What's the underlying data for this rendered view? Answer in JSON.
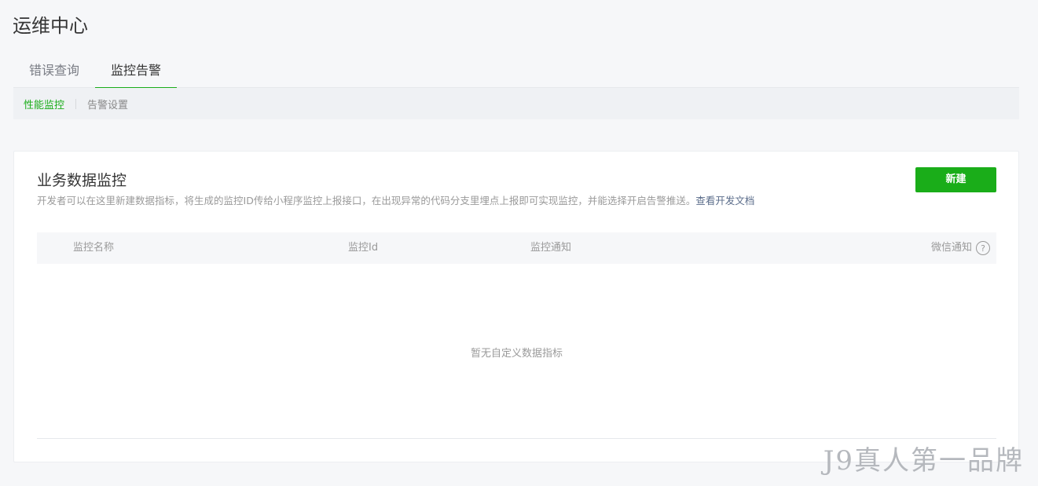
{
  "page": {
    "title": "运维中心"
  },
  "tabs": [
    {
      "label": "错误查询",
      "active": false
    },
    {
      "label": "监控告警",
      "active": true
    }
  ],
  "sub_tabs": [
    {
      "label": "性能监控",
      "active": true
    },
    {
      "label": "告警设置",
      "active": false
    }
  ],
  "card": {
    "title": "业务数据监控",
    "description": "开发者可以在这里新建数据指标，将生成的监控ID传给小程序监控上报接口，在出现异常的代码分支里埋点上报即可实现监控，并能选择开启告警推送。",
    "doc_link": "查看开发文档",
    "new_button": "新建"
  },
  "table": {
    "columns": [
      "监控名称",
      "监控Id",
      "监控通知",
      "微信通知"
    ],
    "help_icon": "?",
    "empty_text": "暂无自定义数据指标"
  },
  "watermark": "J9真人第一品牌",
  "colors": {
    "accent": "#1aad19",
    "link": "#5a6c8a",
    "muted_text": "#9a9a9a"
  }
}
